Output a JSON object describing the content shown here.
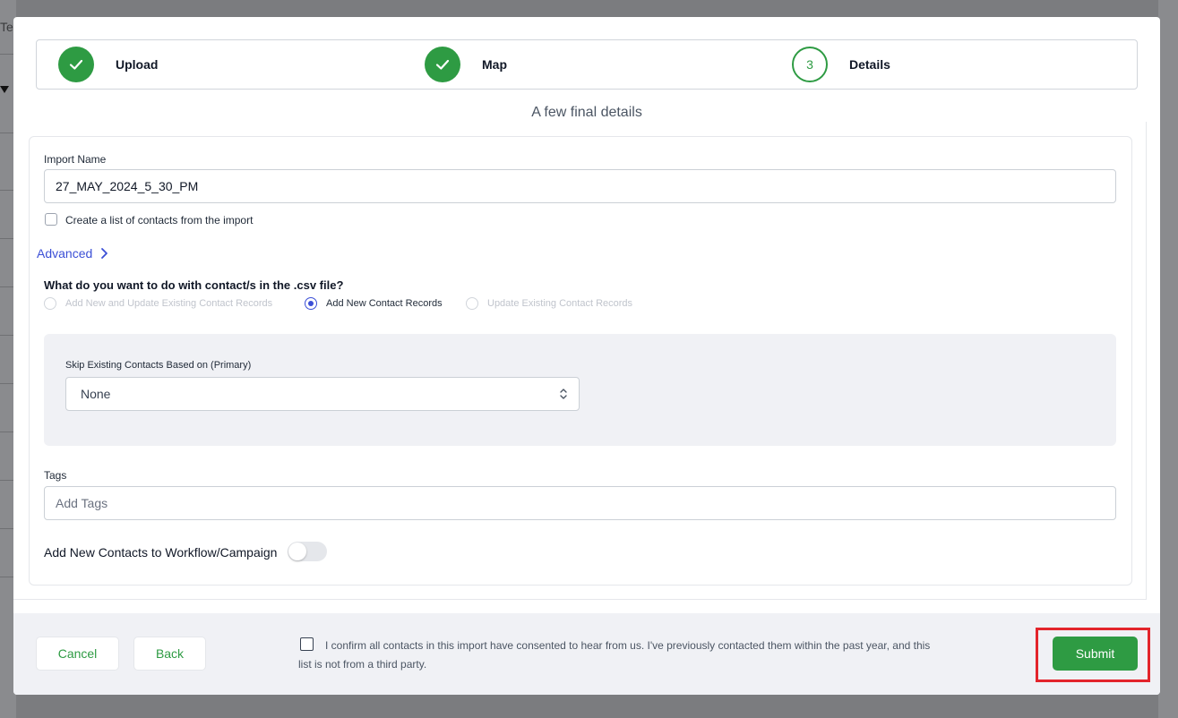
{
  "background": {
    "partial_text": "Tes"
  },
  "stepper": {
    "steps": [
      {
        "label": "Upload",
        "state": "done",
        "icon": "check-icon"
      },
      {
        "label": "Map",
        "state": "done",
        "icon": "check-icon"
      },
      {
        "label": "Details",
        "state": "current",
        "number": "3"
      }
    ]
  },
  "subtitle": "A few final details",
  "form": {
    "import_name_label": "Import Name",
    "import_name_value": "27_MAY_2024_5_30_PM",
    "create_list_label": "Create a list of contacts from the import",
    "create_list_checked": false,
    "advanced_label": "Advanced",
    "question": "What do you want to do with contact/s in the .csv file?",
    "options": [
      {
        "label": "Add New and Update Existing Contact Records",
        "selected": false,
        "disabled": true
      },
      {
        "label": "Add New Contact Records",
        "selected": true,
        "disabled": false
      },
      {
        "label": "Update Existing Contact Records",
        "selected": false,
        "disabled": true
      }
    ],
    "skip_label": "Skip Existing Contacts Based on (Primary)",
    "skip_value": "None",
    "tags_label": "Tags",
    "tags_placeholder": "Add Tags",
    "workflow_label": "Add New Contacts to Workflow/Campaign",
    "workflow_enabled": false
  },
  "footer": {
    "cancel_label": "Cancel",
    "back_label": "Back",
    "consent_text": "I confirm all contacts in this import have consented to hear from us. I've previously contacted them within the past year, and this list is not from a third party.",
    "consent_checked": false,
    "submit_label": "Submit"
  },
  "colors": {
    "accent_green": "#2e9b43",
    "link_blue": "#3b4fd6",
    "highlight_red": "#e3242b"
  }
}
